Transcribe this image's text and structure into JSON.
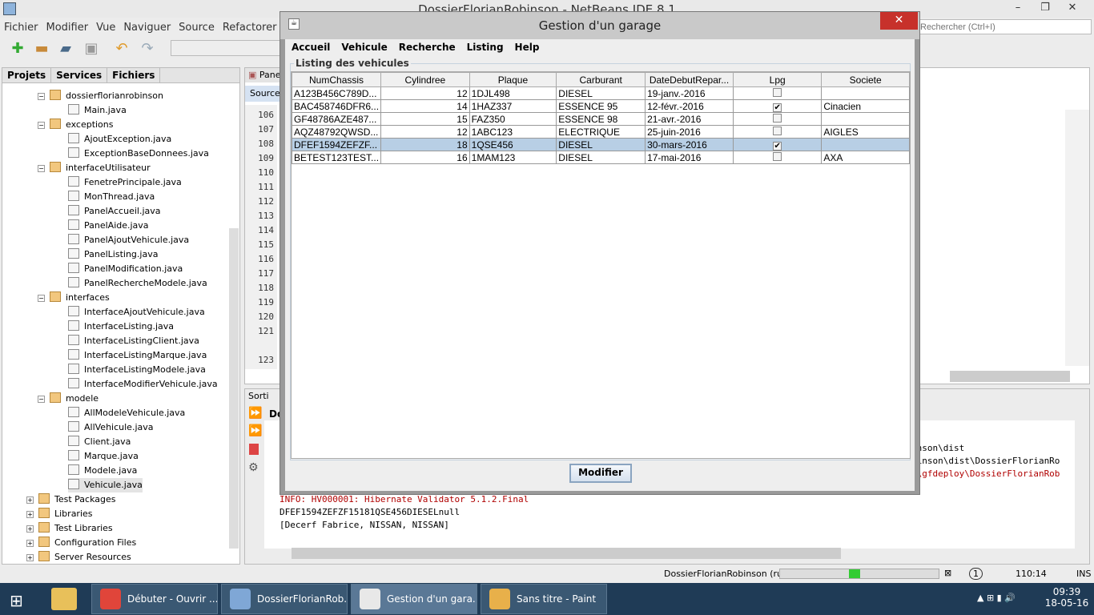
{
  "ide": {
    "title": "DossierFlorianRobinson - NetBeans IDE 8.1",
    "menu": [
      "Fichier",
      "Modifier",
      "Vue",
      "Naviguer",
      "Source",
      "Refactorer",
      "Exécuter"
    ],
    "search_placeholder": "Rechercher (Ctrl+I)",
    "panel_tabs": [
      "Projets",
      "Services",
      "Fichiers"
    ],
    "tree": [
      {
        "label": "dossierflorianrobinson",
        "level": 1,
        "type": "package"
      },
      {
        "label": "Main.java",
        "level": 2,
        "type": "file"
      },
      {
        "label": "exceptions",
        "level": 1,
        "type": "package"
      },
      {
        "label": "AjoutException.java",
        "level": 2,
        "type": "file"
      },
      {
        "label": "ExceptionBaseDonnees.java",
        "level": 2,
        "type": "file"
      },
      {
        "label": "interfaceUtilisateur",
        "level": 1,
        "type": "package"
      },
      {
        "label": "FenetrePrincipale.java",
        "level": 2,
        "type": "file"
      },
      {
        "label": "MonThread.java",
        "level": 2,
        "type": "file"
      },
      {
        "label": "PanelAccueil.java",
        "level": 2,
        "type": "file"
      },
      {
        "label": "PanelAide.java",
        "level": 2,
        "type": "file"
      },
      {
        "label": "PanelAjoutVehicule.java",
        "level": 2,
        "type": "file"
      },
      {
        "label": "PanelListing.java",
        "level": 2,
        "type": "file"
      },
      {
        "label": "PanelModification.java",
        "level": 2,
        "type": "file"
      },
      {
        "label": "PanelRechercheModele.java",
        "level": 2,
        "type": "file"
      },
      {
        "label": "interfaces",
        "level": 1,
        "type": "package"
      },
      {
        "label": "InterfaceAjoutVehicule.java",
        "level": 2,
        "type": "file"
      },
      {
        "label": "InterfaceListing.java",
        "level": 2,
        "type": "file"
      },
      {
        "label": "InterfaceListingClient.java",
        "level": 2,
        "type": "file"
      },
      {
        "label": "InterfaceListingMarque.java",
        "level": 2,
        "type": "file"
      },
      {
        "label": "InterfaceListingModele.java",
        "level": 2,
        "type": "file"
      },
      {
        "label": "InterfaceModifierVehicule.java",
        "level": 2,
        "type": "file"
      },
      {
        "label": "modele",
        "level": 1,
        "type": "package"
      },
      {
        "label": "AllModeleVehicule.java",
        "level": 2,
        "type": "file"
      },
      {
        "label": "AllVehicule.java",
        "level": 2,
        "type": "file"
      },
      {
        "label": "Client.java",
        "level": 2,
        "type": "file"
      },
      {
        "label": "Marque.java",
        "level": 2,
        "type": "file"
      },
      {
        "label": "Modele.java",
        "level": 2,
        "type": "file"
      },
      {
        "label": "Vehicule.java",
        "level": 2,
        "type": "file"
      },
      {
        "label": "Test Packages",
        "level": 0,
        "type": "folder"
      },
      {
        "label": "Libraries",
        "level": 0,
        "type": "folder"
      },
      {
        "label": "Test Libraries",
        "level": 0,
        "type": "folder"
      },
      {
        "label": "Configuration Files",
        "level": 0,
        "type": "folder"
      },
      {
        "label": "Server Resources",
        "level": 0,
        "type": "folder"
      }
    ],
    "editor_tab": "Pane",
    "source_tab": "Source",
    "line_numbers": [
      "106",
      "107",
      "108",
      "109",
      "110",
      "111",
      "112",
      "113",
      "114",
      "115",
      "116",
      "117",
      "118",
      "119",
      "120",
      "121",
      "",
      "123"
    ],
    "output_tab": "Sorti",
    "output_subtab": "Do",
    "output_lines": [
      {
        "text": "inson\\dist",
        "color": "#000000",
        "offset": true
      },
      {
        "text": "binson\\dist\\DossierFlorianRo",
        "color": "#000000",
        "offset": true
      },
      {
        "text": "c\\gfdeploy\\DossierFlorianRob",
        "color": "#b00000",
        "offset": true
      },
      {
        "text": "INFO: HV000001: Hibernate Validator 5.1.2.Final",
        "color": "#b00000"
      },
      {
        "text": "DFEF1594ZEFZF15181QSE456DIESELnull",
        "color": "#000000"
      },
      {
        "text": "[Decerf Fabrice, NISSAN, NISSAN]",
        "color": "#000000"
      }
    ],
    "status": {
      "run": "DossierFlorianRobinson (run)",
      "progress": 0.4,
      "notif": "1",
      "position": "110:14",
      "mode": "INS"
    }
  },
  "dialog": {
    "title": "Gestion d'un garage",
    "menu": [
      "Accueil",
      "Vehicule",
      "Recherche",
      "Listing",
      "Help"
    ],
    "group_title": "Listing des vehicules",
    "columns": [
      "NumChassis",
      "Cylindree",
      "Plaque",
      "Carburant",
      "DateDebutRepar...",
      "Lpg",
      "Societe"
    ],
    "rows": [
      {
        "num": "A123B456C789D...",
        "cyl": "12",
        "plaque": "1DJL498",
        "carb": "DIESEL",
        "date": "19-janv.-2016",
        "lpg": false,
        "soc": ""
      },
      {
        "num": "BAC458746DFR6...",
        "cyl": "14",
        "plaque": "1HAZ337",
        "carb": "ESSENCE 95",
        "date": "12-févr.-2016",
        "lpg": true,
        "soc": "Cinacien"
      },
      {
        "num": "GF48786AZE487...",
        "cyl": "15",
        "plaque": "FAZ350",
        "carb": "ESSENCE 98",
        "date": "21-avr.-2016",
        "lpg": false,
        "soc": ""
      },
      {
        "num": "AQZ48792QWSD...",
        "cyl": "12",
        "plaque": "1ABC123",
        "carb": "ELECTRIQUE",
        "date": "25-juin-2016",
        "lpg": false,
        "soc": "AIGLES"
      },
      {
        "num": "DFEF1594ZEFZF...",
        "cyl": "18",
        "plaque": "1QSE456",
        "carb": "DIESEL",
        "date": "30-mars-2016",
        "lpg": true,
        "soc": "",
        "selected": true
      },
      {
        "num": "BETEST123TEST...",
        "cyl": "16",
        "plaque": "1MAM123",
        "carb": "DIESEL",
        "date": "17-mai-2016",
        "lpg": false,
        "soc": "AXA"
      }
    ],
    "button": "Modifier"
  },
  "taskbar": {
    "items": [
      {
        "label": "Débuter - Ouvrir ...",
        "color": "#e0453a"
      },
      {
        "label": "DossierFlorianRob...",
        "color": "#7fa7d6"
      },
      {
        "label": "Gestion d'un gara...",
        "color": "#e8e8e8",
        "active": true
      },
      {
        "label": "Sans titre - Paint",
        "color": "#e8b04a"
      }
    ],
    "time": "09:39",
    "date": "18-05-16"
  }
}
